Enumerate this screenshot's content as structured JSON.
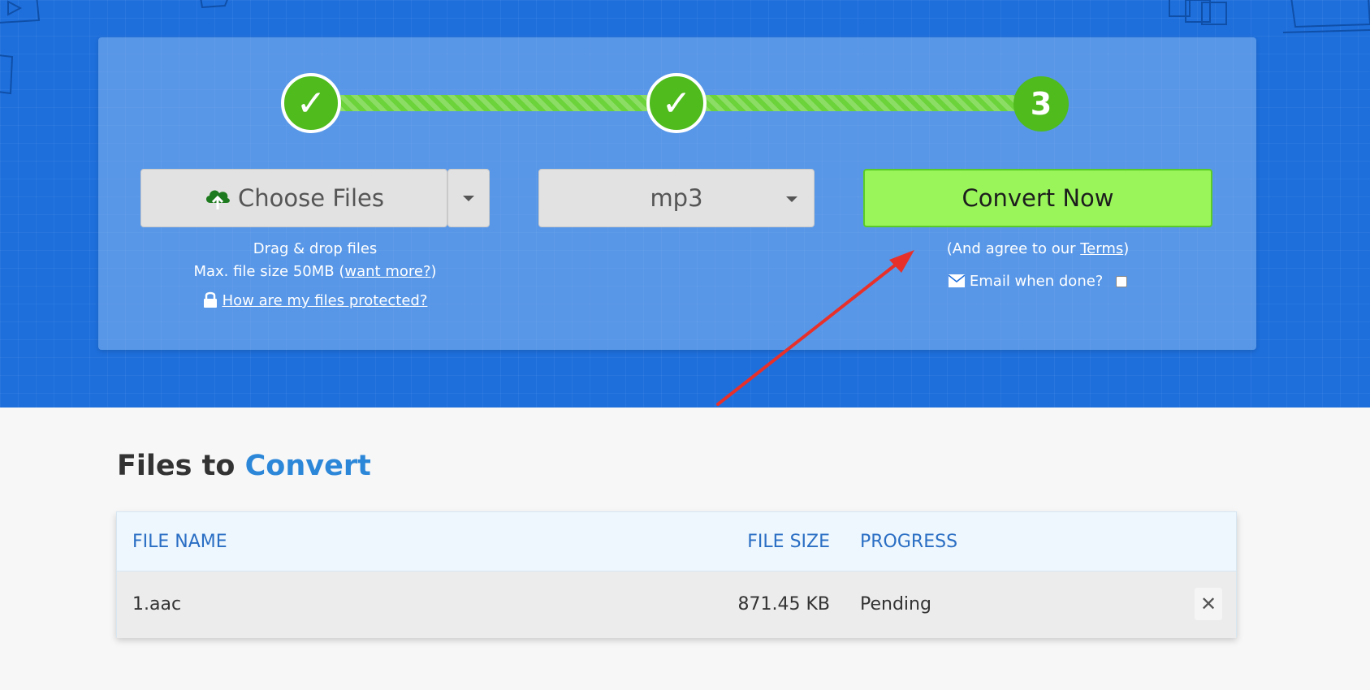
{
  "steps": [
    {
      "state": "done",
      "glyph": "✓"
    },
    {
      "state": "done",
      "glyph": "✓"
    },
    {
      "state": "current",
      "label": "3"
    }
  ],
  "upload": {
    "choose_label": "Choose Files",
    "drag_hint": "Drag & drop files",
    "max_size_prefix": "Max. file size 50MB (",
    "want_more_link": "want more?",
    "max_size_suffix": ")",
    "protected_link": "How are my files protected?"
  },
  "format": {
    "selected": "mp3"
  },
  "convert": {
    "button_label": "Convert Now",
    "terms_prefix": "(And agree to our ",
    "terms_link": "Terms",
    "terms_suffix": ")",
    "email_label": "Email when done?"
  },
  "files_section": {
    "title_prefix": "Files to ",
    "title_accent": "Convert",
    "columns": [
      "FILE NAME",
      "FILE SIZE",
      "PROGRESS"
    ],
    "rows": [
      {
        "name": "1.aac",
        "size": "871.45 KB",
        "progress": "Pending"
      }
    ],
    "remove_glyph": "✕"
  },
  "colors": {
    "hero_blue": "#1e6fdc",
    "step_green": "#4fbb1d",
    "convert_green": "#99f55a",
    "accent_blue": "#2d87d9",
    "annotation_red": "#e8302a"
  },
  "icons": [
    "cloud-upload-icon",
    "caret-down-icon",
    "lock-icon",
    "envelope-icon",
    "close-icon",
    "check-icon"
  ]
}
